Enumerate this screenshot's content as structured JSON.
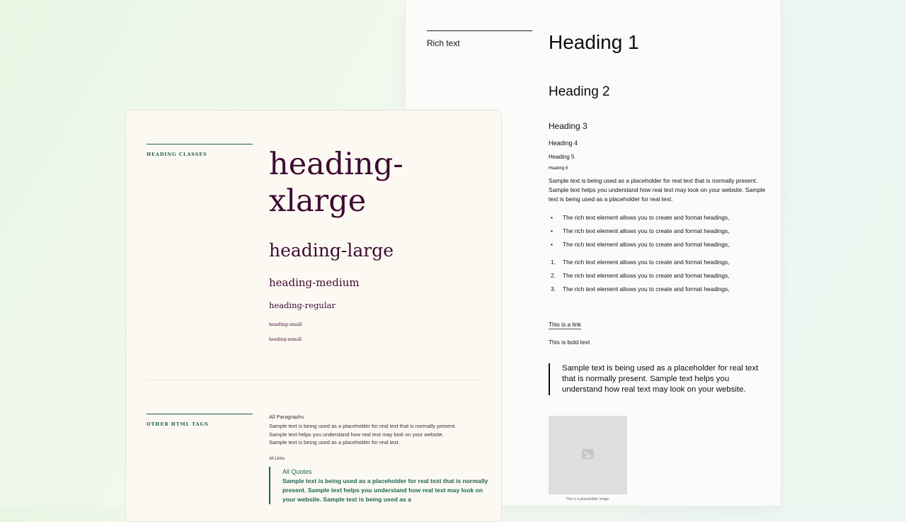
{
  "rich_text": {
    "label": "Rich text",
    "h1": "Heading 1",
    "h2": "Heading 2",
    "h3": "Heading 3",
    "h4": "Heading 4",
    "h5": "Heading 5",
    "h6": "Heading 6",
    "paragraph": "Sample text is being used as a placeholder for real text that is normally present. Sample text helps you understand how real text may look on your website. Sample text is being used as a placeholder for real text.",
    "bullets": [
      "The rich text element allows you to create and format headings,",
      "The rich text element allows you to create and format headings,",
      "The rich text element allows you to create and format headings,"
    ],
    "numbered": [
      {
        "num": "1.",
        "text": "The rich text element allows you to create and format headings,"
      },
      {
        "num": "2.",
        "text": "The rich text element allows you to create and format headings,"
      },
      {
        "num": "3.",
        "text": "The rich text element allows you to create and format headings,"
      }
    ],
    "link": "This is a link",
    "bold": "This is bold text",
    "quote": "Sample text is being used as a placeholder for real text that is normally present. Sample text helps you understand how real text may look on your website.",
    "image_caption": "This is a placeholder image."
  },
  "heading_classes": {
    "label": "HEADING CLASSES",
    "xlarge": "heading-xlarge",
    "large": "heading-large",
    "medium": "heading-medium",
    "regular": "heading-regular",
    "small": "heading-small",
    "xsmall": "heading-xsmall"
  },
  "other_tags": {
    "label": "OTHER HTML TAGS",
    "paragraphs_title": "All Paragraphs",
    "paragraphs_text": "Sample text is being used as a placeholder for real text that is normally present. Sample text helps you understand how real text may look on your website. Sample text is being used as a placeholder for real text.",
    "links_title": "All Links",
    "quotes_title": "All Quotes",
    "quotes_text": "Sample text is being used as a placeholder for real text that is normally present. Sample text helps you understand how real text may look on your website. Sample text is being used as a"
  },
  "colors": {
    "heading_purple": "#3d0a33",
    "accent_green": "#215e4d",
    "cream_bg": "#fcf9f3"
  },
  "icons": {
    "image_placeholder": "image-icon"
  }
}
